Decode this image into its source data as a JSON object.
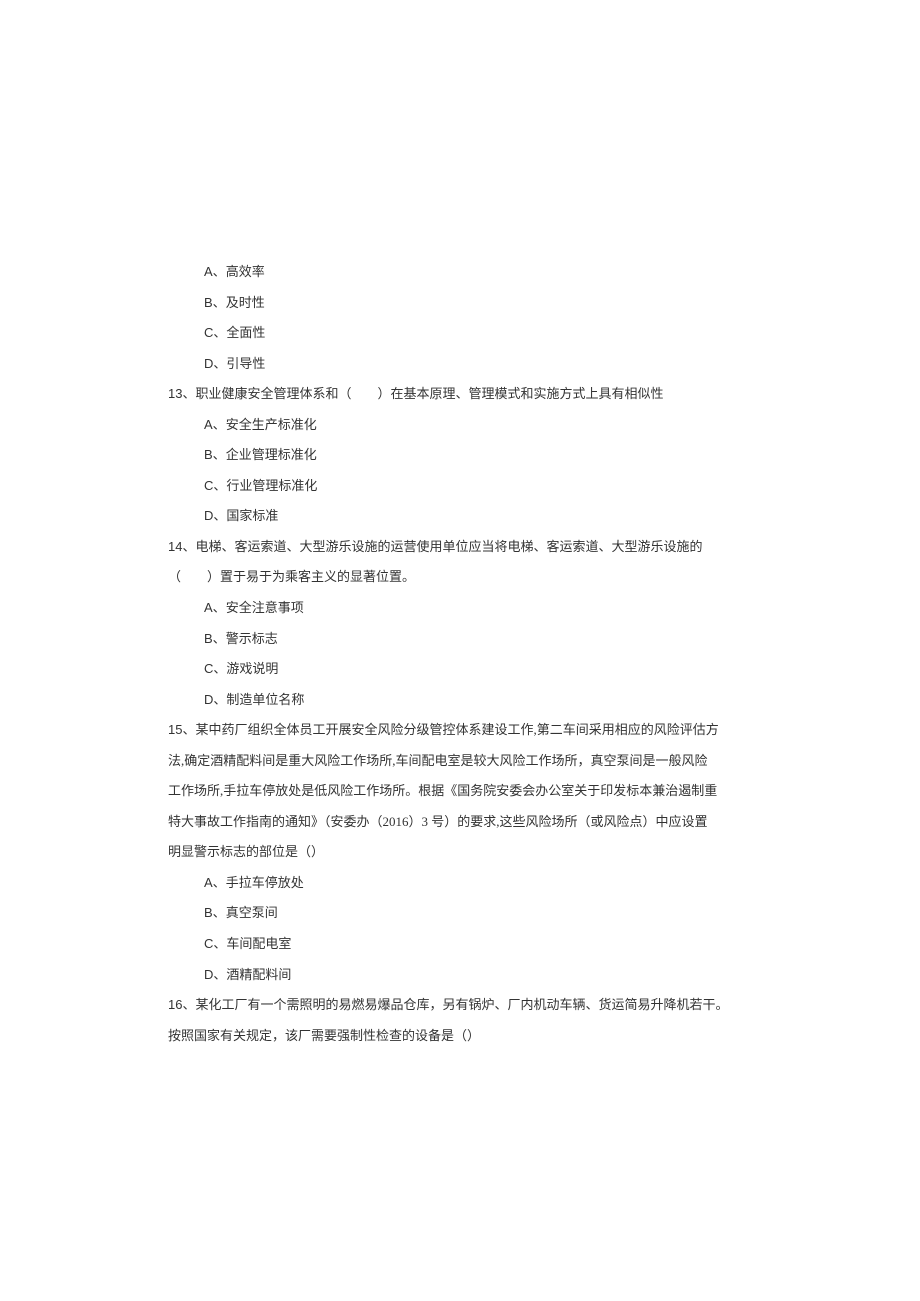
{
  "q12": {
    "options": {
      "A": "高效率",
      "B": "及时性",
      "C": "全面性",
      "D": "引导性"
    }
  },
  "q13": {
    "num": "13",
    "text_before": "、职业健康安全管理体系和（　　）在基本原理、管理模式和实施方式上具有相似性",
    "options": {
      "A": "安全生产标准化",
      "B": "企业管理标准化",
      "C": "行业管理标准化",
      "D": "国家标准"
    }
  },
  "q14": {
    "num": "14",
    "line1": "、电梯、客运索道、大型游乐设施的运营使用单位应当将电梯、客运索道、大型游乐设施的",
    "line2": "（　　）置于易于为乘客主义的显著位置。",
    "options": {
      "A": "安全注意事项",
      "B": "警示标志",
      "C": "游戏说明",
      "D": "制造单位名称"
    }
  },
  "q15": {
    "num": "15",
    "line1": "、某中药厂组织全体员工开展安全风险分级管控体系建设工作,第二车间采用相应的风险评估方",
    "line2": "法,确定酒精配料间是重大风险工作场所,车间配电室是较大风险工作场所，真空泵间是一般风险",
    "line3a": "工作场所,手拉车停放处是低风险工作场所。根据《国务院安委会办公室关于印发标本兼治遏制重",
    "line3b": "特大事故工作指南的通知》（安委办（2016）3 号）的要求,这些风险场所（或风险点）中应设置",
    "line4": "明显警示标志的部位是（）",
    "options": {
      "A": "手拉车停放处",
      "B": "真空泵间",
      "C": "车间配电室",
      "D": "酒精配料间"
    }
  },
  "q16": {
    "num": "16",
    "line1": "、某化工厂有一个需照明的易燃易爆品仓库，另有锅炉、厂内机动车辆、货运简易升降机若干。",
    "line2": "按照国家有关规定，该厂需要强制性检查的设备是（）"
  },
  "letters": {
    "A": "A",
    "B": "B",
    "C": "C",
    "D": "D"
  },
  "sep": "、"
}
